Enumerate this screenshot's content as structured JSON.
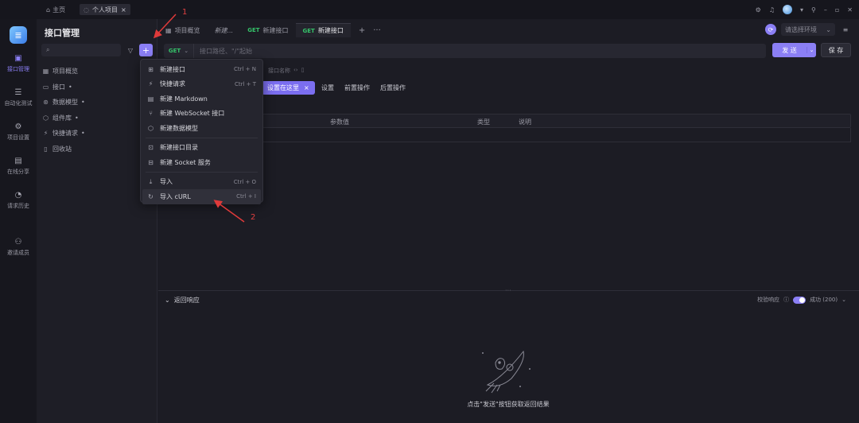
{
  "titlebar": {
    "home_label": "主页",
    "project_tab": "个人项目"
  },
  "nav": [
    {
      "label": "接口管理",
      "icon": "api-icon",
      "active": true
    },
    {
      "label": "自动化测试",
      "icon": "automation-icon"
    },
    {
      "label": "项目设置",
      "icon": "settings-icon"
    },
    {
      "label": "在线分享",
      "icon": "share-icon"
    },
    {
      "label": "请求历史",
      "icon": "history-icon"
    },
    {
      "label": "邀请成员",
      "icon": "invite-icon"
    }
  ],
  "sidebar": {
    "title": "接口管理",
    "tree": [
      {
        "label": "项目概览",
        "icon": "overview-icon"
      },
      {
        "label": "接口",
        "icon": "folder-icon"
      },
      {
        "label": "数据模型",
        "icon": "model-icon"
      },
      {
        "label": "组件库",
        "icon": "component-icon"
      },
      {
        "label": "快捷请求",
        "icon": "quick-request-icon"
      },
      {
        "label": "回收站",
        "icon": "trash-icon"
      }
    ]
  },
  "main": {
    "tabs": [
      {
        "label": "项目概览",
        "method": ""
      },
      {
        "label": "新建...",
        "method": ""
      },
      {
        "label": "新建接口",
        "method": "GET"
      },
      {
        "label": "新建接口",
        "method": "GET",
        "active": true
      }
    ],
    "env_placeholder": "请选择环境",
    "method": "GET",
    "url_placeholder": "接口路径、\"/\"起始",
    "send_label": "发 送",
    "save_label": "保 存",
    "meta_text": "接口名称",
    "tooltip_text": "设置在这里",
    "subtabs": [
      "设置",
      "前置操作",
      "后置操作"
    ],
    "table_headers": {
      "value": "参数值",
      "type": "类型",
      "desc": "说明"
    },
    "response_label": "返回响应",
    "validate_label": "校验响应",
    "status_label": "成功 (200)",
    "empty_text": "点击\"发送\"按钮获取返回结果"
  },
  "menu": {
    "items": [
      {
        "label": "新建接口",
        "shortcut": "Ctrl + N",
        "icon": "new-api-icon"
      },
      {
        "label": "快捷请求",
        "shortcut": "Ctrl + T",
        "icon": "lightning-icon"
      },
      {
        "label": "新建 Markdown",
        "shortcut": "",
        "icon": "markdown-icon"
      },
      {
        "label": "新建 WebSocket 接口",
        "shortcut": "",
        "icon": "websocket-icon"
      },
      {
        "label": "新建数据模型",
        "shortcut": "",
        "icon": "cube-icon"
      }
    ],
    "items2": [
      {
        "label": "新建接口目录",
        "shortcut": "",
        "icon": "folder-plus-icon"
      },
      {
        "label": "新建 Socket 服务",
        "shortcut": "",
        "icon": "socket-icon"
      }
    ],
    "items3": [
      {
        "label": "导入",
        "shortcut": "Ctrl + O",
        "icon": "import-icon"
      },
      {
        "label": "导入 cURL",
        "shortcut": "Ctrl + I",
        "icon": "curl-icon"
      }
    ]
  },
  "annotations": {
    "step1": "1",
    "step2": "2"
  }
}
